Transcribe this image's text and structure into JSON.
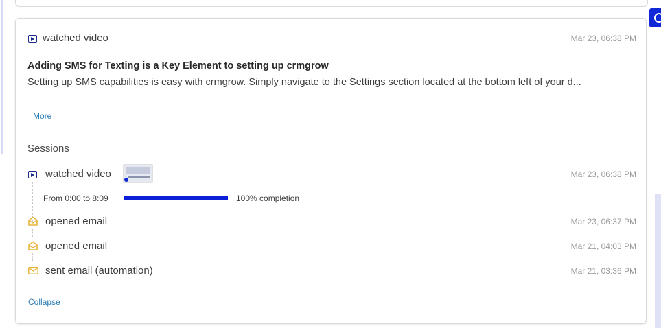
{
  "activity": {
    "type_label": "watched video",
    "time": "Mar 23, 06:38 PM",
    "title": "Adding SMS for Texting is a Key Element to setting up crmgrow",
    "description": "Setting up SMS capabilities is easy with crmgrow. Simply navigate to the Settings section located at the bottom left of your d...",
    "more_label": "More"
  },
  "sessions": {
    "heading": "Sessions",
    "items": [
      {
        "label": "watched video",
        "time": "Mar 23, 06:38 PM",
        "icon": "video-play-icon",
        "progress_range": "From 0:00 to 8:09",
        "progress_completion": "100% completion",
        "progress_fraction": 1.0
      },
      {
        "label": "opened email",
        "time": "Mar 23, 06:37 PM",
        "icon": "envelope-open-icon"
      },
      {
        "label": "opened email",
        "time": "Mar 21, 04:03 PM",
        "icon": "envelope-open-icon"
      },
      {
        "label": "sent email (automation)",
        "time": "Mar 21, 03:36 PM",
        "icon": "envelope-icon"
      }
    ],
    "collapse_label": "Collapse"
  },
  "colors": {
    "accent": "#0a1fd6",
    "link": "#2a7db5",
    "email_icon": "#e8b43a",
    "video_icon": "#1a2a8a"
  }
}
